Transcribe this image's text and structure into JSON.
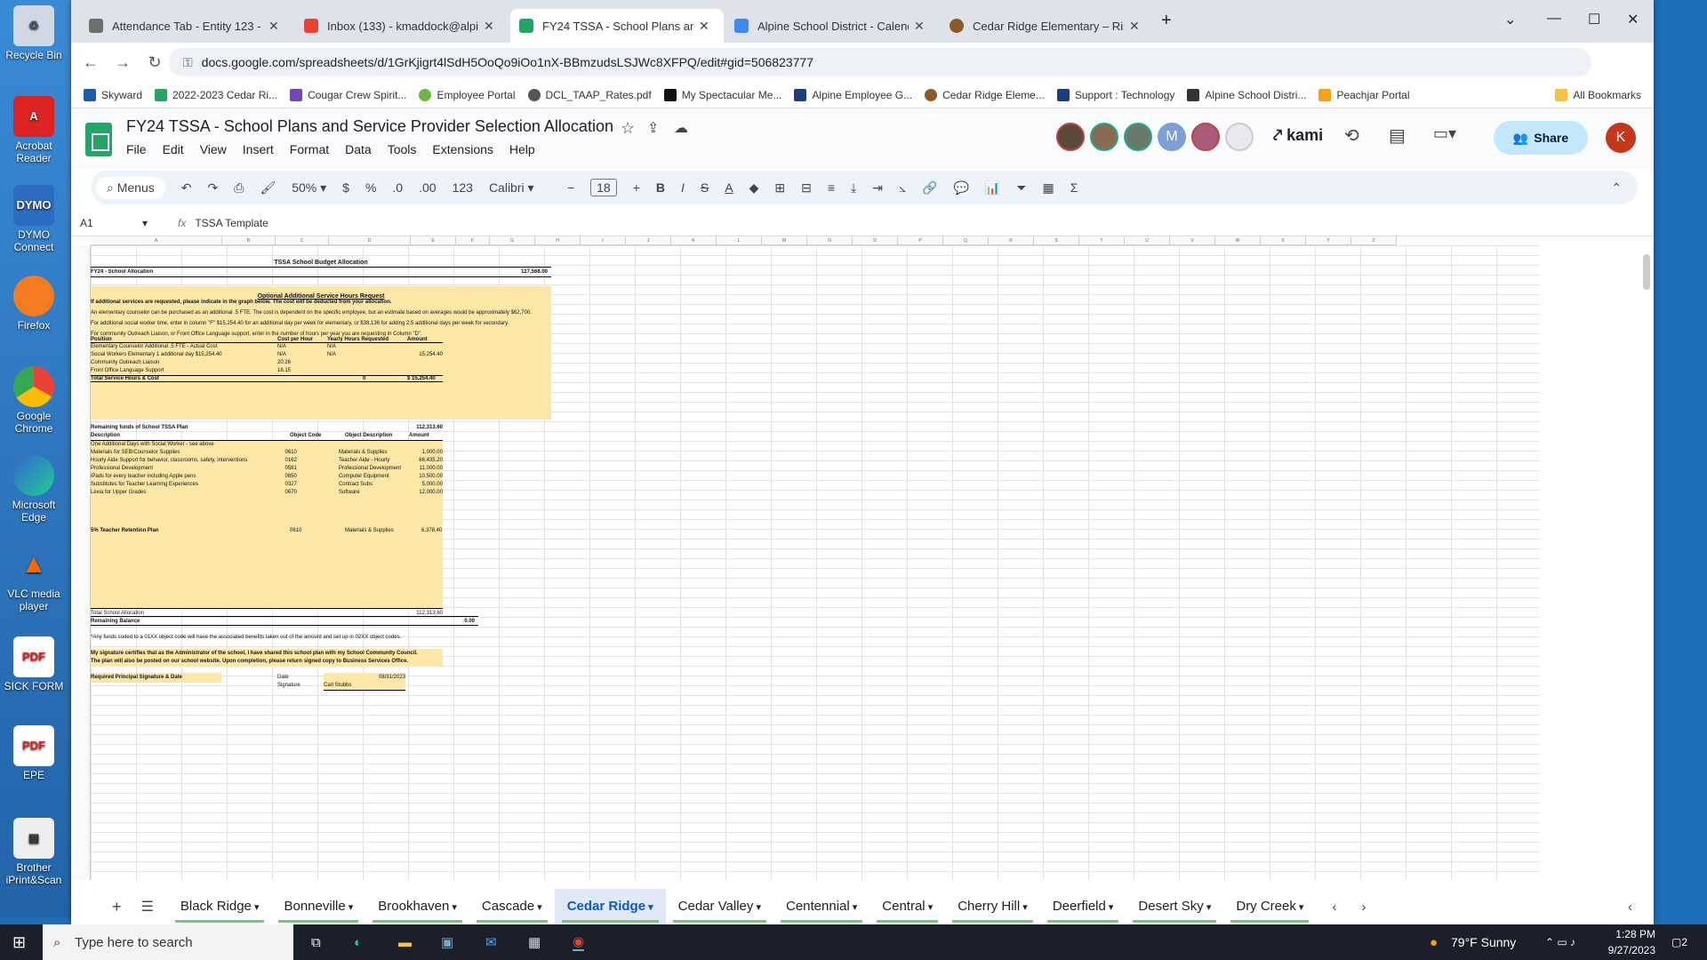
{
  "desktop": {
    "icons": [
      {
        "name": "recycle-bin",
        "label": "Recycle Bin"
      },
      {
        "name": "acrobat",
        "label": "Acrobat Reader"
      },
      {
        "name": "dymo",
        "label": "DYMO Connect"
      },
      {
        "name": "firefox",
        "label": "Firefox"
      },
      {
        "name": "chrome",
        "label": "Google Chrome"
      },
      {
        "name": "edge",
        "label": "Microsoft Edge"
      },
      {
        "name": "vlc",
        "label": "VLC media player"
      },
      {
        "name": "sick-form",
        "label": "SICK FORM"
      },
      {
        "name": "epe",
        "label": "EPE"
      },
      {
        "name": "brother",
        "label": "Brother iPrint&Scan"
      }
    ]
  },
  "tabs": [
    {
      "title": "Attendance Tab - Entity 123 - WS",
      "color": "#6e6e6e"
    },
    {
      "title": "Inbox (133) - kmaddock@alpinesd",
      "color": "#ea4335"
    },
    {
      "title": "FY24 TSSA - School Plans and Se",
      "color": "#23a566",
      "active": true
    },
    {
      "title": "Alpine School District - Calendar",
      "color": "#4285f4"
    },
    {
      "title": "Cedar Ridge Elementary – Rise Up",
      "color": "#8a5a2b"
    }
  ],
  "url": "docs.google.com/spreadsheets/d/1GrKjigrt4lSdH5OoQo9iOo1nX-BBmzudsLSJWc8XFPQ/edit#gid=506823777",
  "bookmarks": [
    "Skyward",
    "2022-2023 Cedar Ri...",
    "Cougar Crew Spirit...",
    "Employee Portal",
    "DCL_TAAP_Rates.pdf",
    "My Spectacular Me...",
    "Alpine Employee G...",
    "Cedar Ridge Eleme...",
    "Support : Technology",
    "Alpine School Distri...",
    "Peachjar Portal"
  ],
  "all_bookmarks": "All Bookmarks",
  "doc_title": "FY24 TSSA - School Plans and Service Provider Selection Allocation",
  "menus": [
    "File",
    "Edit",
    "View",
    "Insert",
    "Format",
    "Data",
    "Tools",
    "Extensions",
    "Help"
  ],
  "avatars": [
    "M",
    "K"
  ],
  "kami": "kami",
  "share": "Share",
  "account_initial": "K",
  "toolbar": {
    "menus": "Menus",
    "zoom": "50%",
    "currency": "$",
    "percent": "%",
    "dec_less": ".0",
    "dec_more": ".00",
    "format123": "123",
    "font": "Calibri",
    "font_size": "18"
  },
  "formula": {
    "cell_ref": "A1",
    "value": "TSSA Template"
  },
  "columns": [
    "A",
    "B",
    "C",
    "D",
    "E",
    "F",
    "G",
    "H",
    "I",
    "J",
    "K",
    "L",
    "M",
    "N",
    "O",
    "P",
    "Q",
    "R",
    "S",
    "T",
    "U",
    "V",
    "W",
    "X",
    "Y",
    "Z"
  ],
  "sheet": {
    "title": "TSSA School Budget Allocation",
    "fy_label": "FY24 - School Allocation",
    "fy_value": "127,568.00",
    "optional_title": "Optional Additional Service Hours Request",
    "optional_note": "If additional services are requested, please indicate in the graph below.  The cost will be deducted from your allocation.",
    "counselor_note": "An elementary counselor can be purchased as an additional .5 FTE.  The cost is dependent on the specific employee, but an estimate based on averages would be approximately $62,700.",
    "social_note": "For additional social worker time, enter in column \"F\" $15,254.40 for an additional day per week for elementary, or $38,136 for adding 2.5 additional days per week for secondary.",
    "outreach_note": "For community Outreach Liaison, or Front Office Language support, enter in the number of hours per year you are requesting in Column \"D\".",
    "svc_headers": [
      "Position",
      "Cost per Hour",
      "Yearly Hours Requested",
      "Amount"
    ],
    "svc_rows": [
      [
        "Elementary Counselor Additional .5 FTE - Actual Cost",
        "N/A",
        "N/A",
        ""
      ],
      [
        "Social Workers Elementary 1 additional day $15,254.40",
        "N/A",
        "N/A",
        "15,254.40"
      ],
      [
        "Community Outreach Liaison",
        "20.26",
        "",
        ""
      ],
      [
        "Front Office Language Support",
        "18.15",
        "",
        ""
      ]
    ],
    "svc_total": [
      "Total Service Hours & Cost",
      "",
      "0",
      "$     15,254.40"
    ],
    "remaining_label": "Remaining funds of School TSSA Plan",
    "remaining_value": "112,313.60",
    "plan_headers": [
      "Description",
      "Object Code",
      "Object Description",
      "Amount"
    ],
    "plan_rows": [
      [
        "One Additional Days with Social Worker - see above",
        "",
        "",
        ""
      ],
      [
        "Materials for SEB/Counselor Supplies",
        "0610",
        "Materials & Supplies",
        "1,000.00"
      ],
      [
        "Hourly Aide Support for behavior, classrooms, safety, interventions",
        "0162",
        "Teacher Aide - Hourly",
        "66,435.20"
      ],
      [
        "Professional Development",
        "0581",
        "Professional Development",
        "11,000.00"
      ],
      [
        "iPads for every teacher including Apple pens",
        "0650",
        "Computer Equipment",
        "10,500.00"
      ],
      [
        "Substitutes for Teacher Learning Experiences",
        "0327",
        "Contract Subs",
        "5,000.00"
      ],
      [
        "Lexia for Upper Grades",
        "0670",
        "Software",
        "12,000.00"
      ]
    ],
    "retention_row": [
      "5% Teacher Retention Plan",
      "0610",
      "Materials & Supplies",
      "6,378.40"
    ],
    "total_alloc": [
      "Total School Allocation",
      "112,313.60"
    ],
    "remaining_balance": [
      "Remaining Balance",
      "0.00"
    ],
    "benefits_note": "*Any funds coded to a 01XX object code will have the associated benefits taken out of the amount and set up in 02XX object codes.",
    "cert_note": "My signature certifies that as the Administrator of the school, I have shared this school plan with my School Community Council.",
    "plan_note": "The plan will also be posted on our school website.  Upon completion, please return signed copy to Business Services Office.",
    "sig_label": "Required Principal Signature & Date",
    "date_label": "Date",
    "date_value": "08/31/2023",
    "signature_label": "Signature",
    "signature_value": "Carl Stubbs"
  },
  "sheet_tabs": [
    "Black Ridge",
    "Bonneville",
    "Brookhaven",
    "Cascade",
    "Cedar Ridge",
    "Cedar Valley",
    "Centennial",
    "Central",
    "Cherry Hill",
    "Deerfield",
    "Desert Sky",
    "Dry Creek"
  ],
  "active_sheet": "Cedar Ridge",
  "taskbar": {
    "search": "Type here to search",
    "weather": "79°F  Sunny",
    "time": "1:28 PM",
    "date": "9/27/2023",
    "notif": "2"
  }
}
